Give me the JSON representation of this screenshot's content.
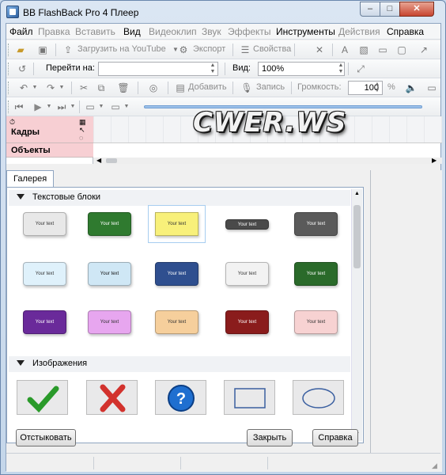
{
  "window": {
    "title": "BB FlashBack Pro 4 Плеер",
    "close_glyph": "✕",
    "min_glyph": "‒",
    "max_glyph": "□"
  },
  "menu": {
    "items": [
      {
        "label": "Файл",
        "enabled": true
      },
      {
        "label": "Правка",
        "enabled": false
      },
      {
        "label": "Вставить",
        "enabled": false
      },
      {
        "label": "Вид",
        "enabled": true
      },
      {
        "label": "Видеоклип",
        "enabled": false
      },
      {
        "label": "Звук",
        "enabled": false
      },
      {
        "label": "Эффекты",
        "enabled": false
      },
      {
        "label": "Инструменты",
        "enabled": true
      },
      {
        "label": "Действия",
        "enabled": false
      },
      {
        "label": "Справка",
        "enabled": true
      }
    ]
  },
  "toolbar1": {
    "upload_label": "Загрузить на YouTube",
    "export_label": "Экспорт",
    "properties_label": "Свойства"
  },
  "toolbar2": {
    "goto_label": "Перейти на:",
    "goto_value": "",
    "view_label": "Вид:",
    "view_value": "100%"
  },
  "toolbar3": {
    "add_label": "Добавить",
    "record_label": "Запись",
    "volume_label": "Громкость:",
    "volume_value": "100",
    "volume_unit": "%"
  },
  "timeline": {
    "frames_label": "Кадры",
    "objects_label": "Объекты",
    "watermark": "CWER.WS"
  },
  "gallery": {
    "tab_label": "Галерея",
    "sections": [
      {
        "label": "Текстовые блоки"
      },
      {
        "label": "Изображения"
      }
    ],
    "text_blocks": [
      {
        "text": "Your text",
        "bg": "#e8e8e8",
        "fg": "#333333"
      },
      {
        "text": "Your text",
        "bg": "#2f7a2f",
        "fg": "#ffffff"
      },
      {
        "text": "Your text",
        "bg": "#f8f07a",
        "fg": "#333333"
      },
      {
        "text": "Your text",
        "bg": "#4a4a4a",
        "fg": "#ffffff"
      },
      {
        "text": "Your text",
        "bg": "#5a5a5a",
        "fg": "#ffffff"
      },
      {
        "text": "Your text",
        "bg": "#dff1fb",
        "fg": "#333333"
      },
      {
        "text": "Your text",
        "bg": "#cfe7f5",
        "fg": "#111111"
      },
      {
        "text": "Your text",
        "bg": "#2f4f8f",
        "fg": "#ffffff"
      },
      {
        "text": "Your text",
        "bg": "#f2f2f2",
        "fg": "#333333"
      },
      {
        "text": "Your text",
        "bg": "#2a6a2a",
        "fg": "#ffffff"
      },
      {
        "text": "Your text",
        "bg": "#6a2a9a",
        "fg": "#ffffff"
      },
      {
        "text": "Your text",
        "bg": "#e7a6ef",
        "fg": "#333333"
      },
      {
        "text": "Your text",
        "bg": "#f6cf9c",
        "fg": "#333333"
      },
      {
        "text": "Your text",
        "bg": "#8a1c1c",
        "fg": "#ffffff"
      },
      {
        "text": "Your text",
        "bg": "#f7d2d2",
        "fg": "#333333"
      }
    ],
    "images": [
      {
        "icon": "checkmark-icon"
      },
      {
        "icon": "cross-icon"
      },
      {
        "icon": "question-icon"
      },
      {
        "icon": "rectangle-shape-icon"
      },
      {
        "icon": "ellipse-shape-icon"
      }
    ]
  },
  "buttons": {
    "undock": "Отстыковать",
    "close": "Закрыть",
    "help": "Справка"
  },
  "colors": {
    "accent": "#4a90d9",
    "selection": "#cfe3f6"
  }
}
